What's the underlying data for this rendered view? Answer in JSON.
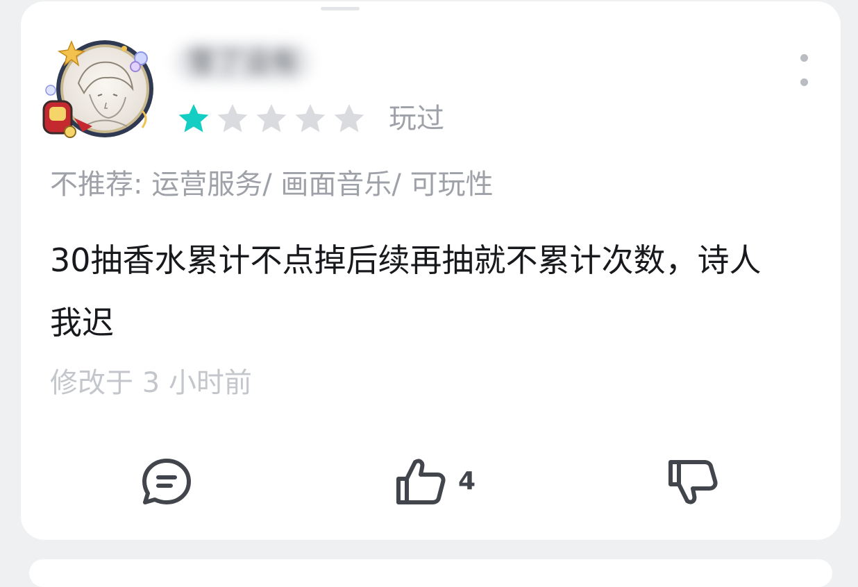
{
  "review": {
    "username": "雪了没有",
    "rating": 1,
    "max_rating": 5,
    "status_label": "玩过",
    "tags_text": "不推荐: 运营服务/ 画面音乐/ 可玩性",
    "content": "30抽香水累计不点掉后续再抽就不累计次数，诗人我迟",
    "modified_time": "修改于 3 小时前"
  },
  "actions": {
    "like_count": "4"
  },
  "icons": {
    "more": "more-vertical-icon",
    "comment": "comment-bubble-icon",
    "like": "thumbs-up-icon",
    "dislike": "thumbs-down-icon",
    "star": "star-icon"
  },
  "colors": {
    "star_active": "#14cdc3",
    "star_inactive": "#d9dbde",
    "muted_text": "#9ea2a8",
    "body_text": "#17191c",
    "icon": "#42464c"
  }
}
